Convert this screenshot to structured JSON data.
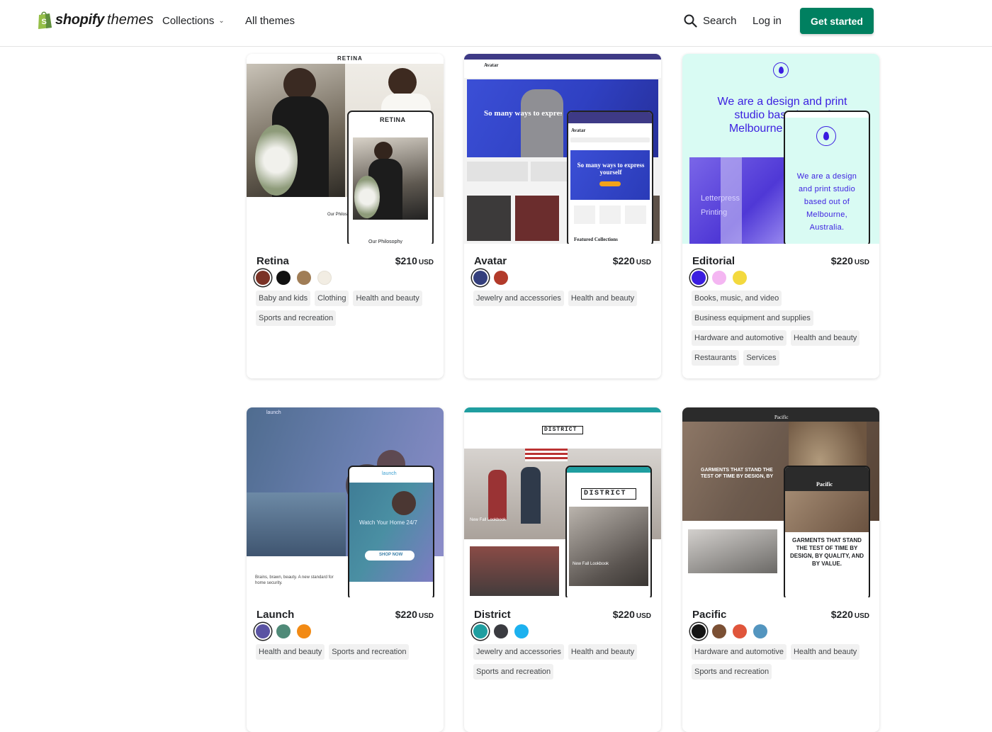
{
  "header": {
    "brand": "shopify",
    "brand_suffix": "themes",
    "nav_collections": "Collections",
    "nav_all_themes": "All themes",
    "search_label": "Search",
    "login_label": "Log in",
    "cta_label": "Get started"
  },
  "themes": [
    {
      "name": "Retina",
      "price": "$210",
      "currency": "USD",
      "swatches": [
        "#7a3226",
        "#111111",
        "#a07d56",
        "#f2ede3"
      ],
      "tags": [
        "Baby and kids",
        "Clothing",
        "Health and beauty",
        "Sports and recreation"
      ],
      "preview": {
        "logo": "RETINA",
        "caption": "Our Philosophy"
      }
    },
    {
      "name": "Avatar",
      "price": "$220",
      "currency": "USD",
      "swatches": [
        "#343f7d",
        "#b23a2a"
      ],
      "tags": [
        "Jewelry and accessories",
        "Health and beauty"
      ],
      "preview": {
        "logo": "Avatar",
        "headline": "So many ways to express yourself",
        "caption": "Featured Collections"
      }
    },
    {
      "name": "Editorial",
      "price": "$220",
      "currency": "USD",
      "swatches": [
        "#3b1ee0",
        "#f4b6f2",
        "#f3d93e"
      ],
      "tags": [
        "Books, music, and video",
        "Business equipment and supplies",
        "Hardware and automotive",
        "Health and beauty",
        "Restaurants",
        "Services"
      ],
      "preview": {
        "headline": "We are a design and print studio based out of Melbourne, Australia.",
        "caption": "Letterpress Printing"
      }
    },
    {
      "name": "Launch",
      "price": "$220",
      "currency": "USD",
      "swatches": [
        "#5a53a3",
        "#4f8a78",
        "#f28a14"
      ],
      "tags": [
        "Health and beauty",
        "Sports and recreation"
      ],
      "preview": {
        "logo": "launch",
        "headline": "Watch Your Home 24/7",
        "caption": "Brains, brawn, beauty. A new standard for home security.",
        "button": "SHOP NOW"
      }
    },
    {
      "name": "District",
      "price": "$220",
      "currency": "USD",
      "swatches": [
        "#1f9ea0",
        "#3a3b40",
        "#1cb1ef"
      ],
      "tags": [
        "Jewelry and accessories",
        "Health and beauty",
        "Sports and recreation"
      ],
      "preview": {
        "logo": "DISTRICT",
        "caption": "New Fall Lookbook"
      }
    },
    {
      "name": "Pacific",
      "price": "$220",
      "currency": "USD",
      "swatches": [
        "#141414",
        "#7b5034",
        "#e0553b",
        "#5395bf"
      ],
      "tags": [
        "Hardware and automotive",
        "Health and beauty",
        "Sports and recreation"
      ],
      "preview": {
        "logo": "Pacific",
        "headline": "GARMENTS THAT STAND THE TEST OF TIME BY DESIGN, BY QUALITY, AND BY VALUE."
      }
    }
  ]
}
